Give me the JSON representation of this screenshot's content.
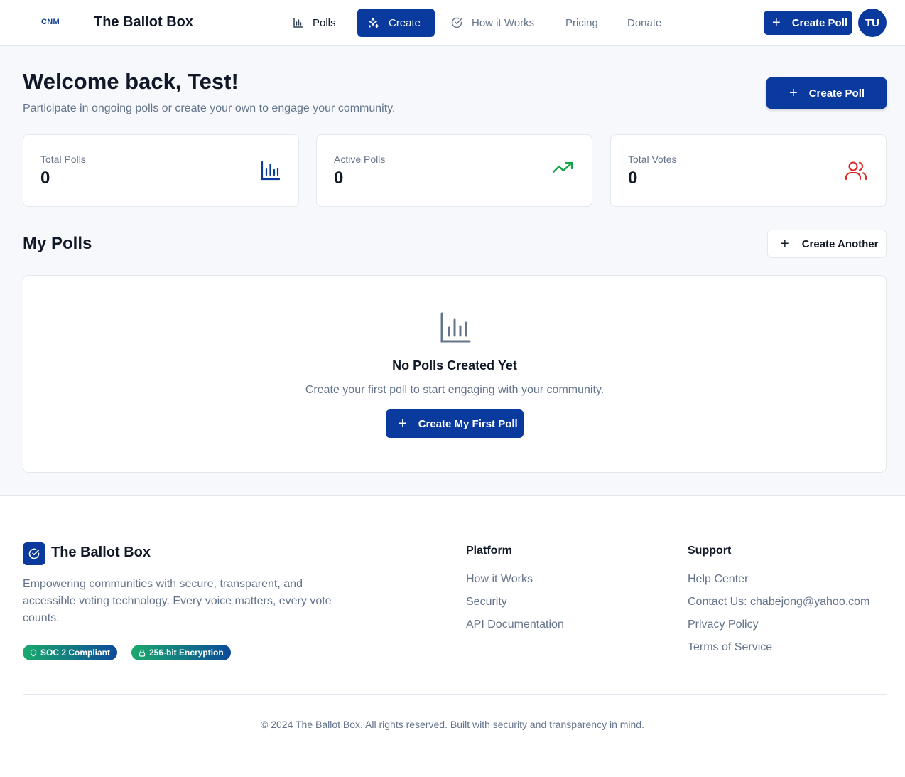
{
  "header": {
    "logo_text": "CNM",
    "brand": "The Ballot Box",
    "nav": [
      {
        "label": "Polls",
        "icon": "bar-chart-icon"
      },
      {
        "label": "Create",
        "icon": "sparkles-icon",
        "active": true
      },
      {
        "label": "How it Works",
        "icon": "check-circle-icon"
      },
      {
        "label": "Pricing"
      },
      {
        "label": "Donate"
      }
    ],
    "create_button": "Create Poll",
    "avatar_initials": "TU"
  },
  "welcome": {
    "title": "Welcome back, Test!",
    "subtitle": "Participate in ongoing polls or create your own to engage your community.",
    "create_button": "Create Poll"
  },
  "stats": [
    {
      "label": "Total Polls",
      "value": "0",
      "icon": "bar-chart-icon",
      "color": "#0a3a9e"
    },
    {
      "label": "Active Polls",
      "value": "0",
      "icon": "trending-up-icon",
      "color": "#16a34a"
    },
    {
      "label": "Total Votes",
      "value": "0",
      "icon": "users-icon",
      "color": "#dc2626"
    }
  ],
  "my_polls": {
    "title": "My Polls",
    "create_another": "Create Another",
    "empty_title": "No Polls Created Yet",
    "empty_subtitle": "Create your first poll to start engaging with your community.",
    "empty_button": "Create My First Poll"
  },
  "footer": {
    "brand": "The Ballot Box",
    "description": "Empowering communities with secure, transparent, and accessible voting technology. Every voice matters, every vote counts.",
    "badges": [
      "SOC 2 Compliant",
      "256-bit Encryption"
    ],
    "platform": {
      "title": "Platform",
      "links": [
        "How it Works",
        "Security",
        "API Documentation"
      ]
    },
    "support": {
      "title": "Support",
      "links": [
        "Help Center",
        "Contact Us: chabejong@yahoo.com",
        "Privacy Policy",
        "Terms of Service"
      ]
    },
    "copyright": "© 2024 The Ballot Box. All rights reserved. Built with security and transparency in mind."
  },
  "colors": {
    "primary": "#0a3a9e",
    "background": "#f6f8fb",
    "muted_text": "#64748b",
    "success": "#16a34a",
    "danger": "#dc2626"
  }
}
